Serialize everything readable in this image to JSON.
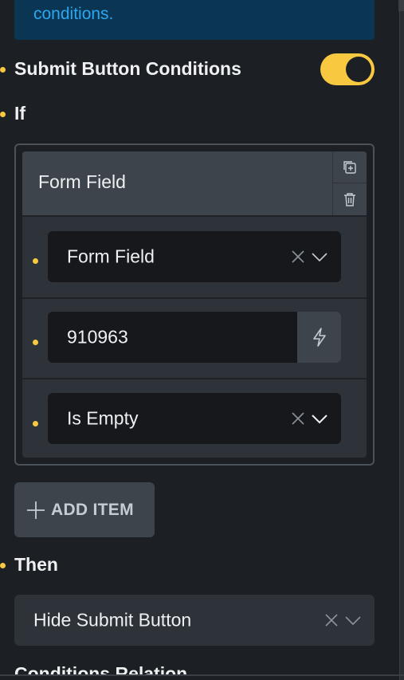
{
  "info_box": {
    "text": "conditions."
  },
  "submit_conditions": {
    "label": "Submit Button Conditions",
    "enabled": true
  },
  "if_section": {
    "label": "If",
    "repeater": {
      "title": "Form Field",
      "rows": [
        {
          "type": "select",
          "value": "Form Field"
        },
        {
          "type": "dynamic-input",
          "value": "910963"
        },
        {
          "type": "select",
          "value": "Is Empty"
        }
      ]
    },
    "add_item_label": "ADD ITEM"
  },
  "then_section": {
    "label": "Then",
    "select_value": "Hide Submit Button"
  },
  "next_section_label": "Conditions Relation",
  "colors": {
    "accent_yellow": "#f8c940",
    "info_bg": "#0b3653",
    "info_text": "#2aa7f0",
    "panel_bg": "#1c1f23"
  }
}
